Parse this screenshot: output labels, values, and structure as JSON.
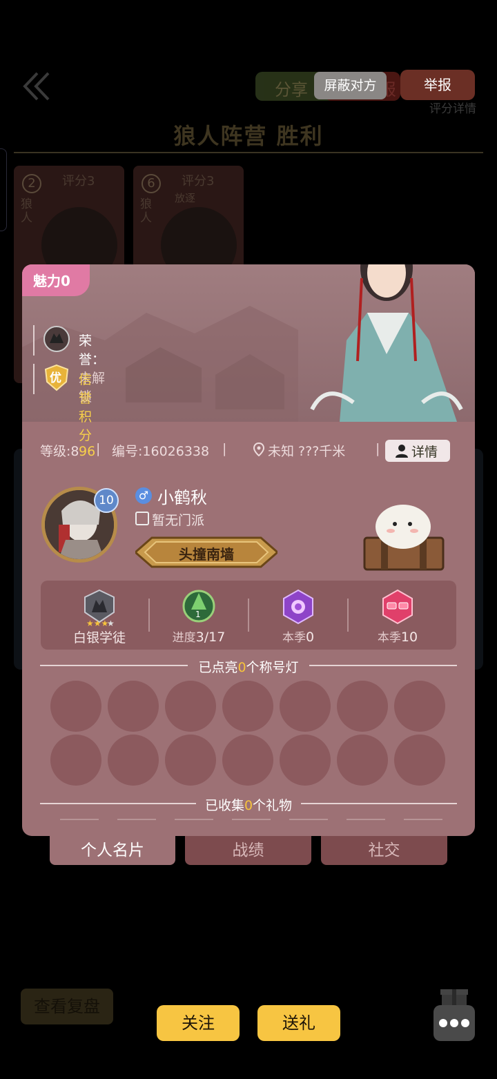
{
  "header": {
    "back_icon": "double-chevron-left-icon",
    "share_label": "分享",
    "report_label_ghost": "报",
    "mask_label": "屏蔽对方",
    "report_label": "举报",
    "score_detail": "评分详情",
    "result_title": "狼人阵营 胜利"
  },
  "bg_cards": [
    {
      "num": "2",
      "rate": "评分3",
      "role": "狼人"
    },
    {
      "num": "6",
      "rate": "评分3",
      "role": "狼人",
      "tag": "放逐"
    }
  ],
  "profile": {
    "charm_label": "魅力0",
    "honor_label": "荣誉：",
    "honor_value": "未解锁",
    "credit_badge": "优",
    "credit_label": "信誉积分96",
    "level": "等级:8",
    "id": "编号:16026338",
    "location": "未知 ???千米",
    "detail_button": "详情",
    "avatar_level": "10",
    "gender_symbol": "♂",
    "nickname": "小鹤秋",
    "sect": "暂无门派",
    "title_plate": "头撞南墙"
  },
  "achievements": [
    {
      "icon": "wolf-emblem-icon",
      "label": "白银学徒"
    },
    {
      "icon": "green-rank-badge-icon",
      "prefix": "进度",
      "value": "3/17",
      "badge_number": "1"
    },
    {
      "icon": "purple-rose-badge-icon",
      "prefix": "本季",
      "value": "0"
    },
    {
      "icon": "pink-sunglasses-badge-icon",
      "prefix": "本季",
      "value": "10"
    }
  ],
  "title_lights": {
    "prefix": "已点亮",
    "count": "0",
    "suffix": "个称号灯"
  },
  "gifts": {
    "prefix": "已收集",
    "count": "0",
    "suffix": "个礼物"
  },
  "tabs": [
    {
      "label": "个人名片",
      "active": true
    },
    {
      "label": "战绩",
      "active": false
    },
    {
      "label": "社交",
      "active": false
    }
  ],
  "footer": {
    "replay_label": "查看复盘",
    "follow_label": "关注",
    "gift_label": "送礼",
    "more_icon": "more-dots-icon"
  },
  "colors": {
    "card_bg": "#9d7175",
    "accent_yellow": "#f7c542",
    "charm_pink": "#e07aa4",
    "highlight": "#f6c33c"
  }
}
